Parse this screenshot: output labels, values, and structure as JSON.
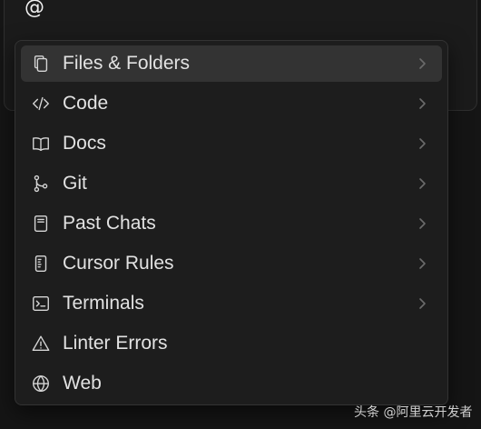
{
  "input": {
    "text": "@"
  },
  "menu": {
    "items": [
      {
        "label": "Files & Folders",
        "icon": "files-icon",
        "has_submenu": true,
        "active": true
      },
      {
        "label": "Code",
        "icon": "code-icon",
        "has_submenu": true,
        "active": false
      },
      {
        "label": "Docs",
        "icon": "book-icon",
        "has_submenu": true,
        "active": false
      },
      {
        "label": "Git",
        "icon": "git-branch-icon",
        "has_submenu": true,
        "active": false
      },
      {
        "label": "Past Chats",
        "icon": "notebook-icon",
        "has_submenu": true,
        "active": false
      },
      {
        "label": "Cursor Rules",
        "icon": "rules-icon",
        "has_submenu": true,
        "active": false
      },
      {
        "label": "Terminals",
        "icon": "terminal-icon",
        "has_submenu": true,
        "active": false
      },
      {
        "label": "Linter Errors",
        "icon": "warning-icon",
        "has_submenu": false,
        "active": false
      },
      {
        "label": "Web",
        "icon": "globe-icon",
        "has_submenu": false,
        "active": false
      }
    ]
  },
  "watermark": {
    "text": "头条 @阿里云开发者"
  },
  "colors": {
    "background": "#151515",
    "menu_background": "#1d1d1d",
    "active_item": "#333333",
    "text": "#e2e2e2",
    "chevron": "#6b6b6b"
  }
}
